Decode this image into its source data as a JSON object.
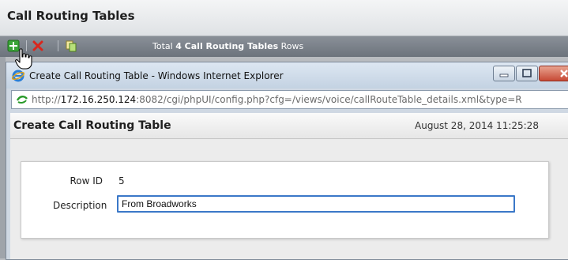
{
  "app": {
    "title": "Call Routing Tables",
    "toolbar": {
      "rows_prefix": "Total",
      "rows_bold": "4 Call Routing Tables",
      "rows_suffix": "Rows"
    }
  },
  "ie_window": {
    "title": "Create Call Routing Table - Windows Internet Explorer",
    "address": {
      "scheme": "http://",
      "host": "172.16.250.124",
      "rest": ":8082/cgi/phpUI/config.php?cfg=/views/voice/callRouteTable_details.xml&type=R"
    }
  },
  "page": {
    "title": "Create Call Routing Table",
    "timestamp": "August 28, 2014 11:25:28"
  },
  "form": {
    "row_id_label": "Row ID",
    "row_id_value": "5",
    "description_label": "Description",
    "description_value": "From Broadworks"
  },
  "colors": {
    "toolbar_bg": "#7b828b",
    "focus_border": "#3b78c8",
    "close_button": "#c74a35"
  },
  "icons": [
    "add-icon",
    "delete-icon",
    "copy-icon",
    "hand-cursor-icon",
    "ie-logo-icon",
    "minimize-icon",
    "maximize-icon",
    "close-icon",
    "page-icon"
  ]
}
